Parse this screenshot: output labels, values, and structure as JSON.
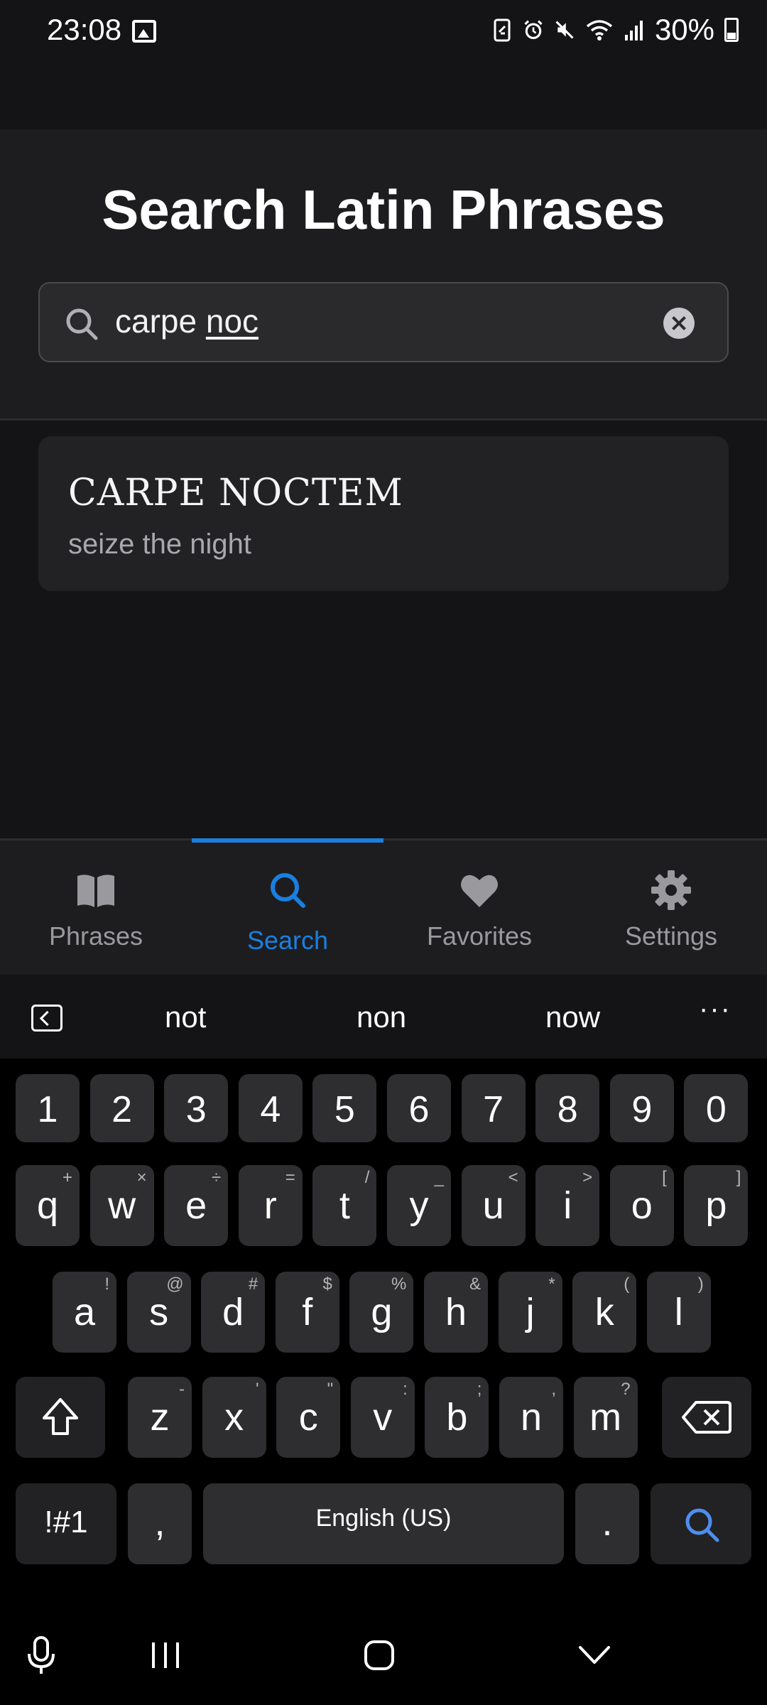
{
  "status_bar": {
    "time": "23:08",
    "battery_percent": "30%",
    "icons": [
      "image-icon",
      "battery-saver-icon",
      "alarm-icon",
      "mute-icon",
      "wifi-icon",
      "signal-icon",
      "battery-icon"
    ]
  },
  "header": {
    "title": "Search Latin Phrases"
  },
  "search": {
    "value_prefix": "carpe ",
    "value_composing": "noc",
    "icon": "search-icon",
    "clear_icon": "clear-icon"
  },
  "results": [
    {
      "latin": "CARPE NOCTEM",
      "translation": "seize the night"
    }
  ],
  "bottom_nav": {
    "items": [
      {
        "label": "Phrases",
        "icon": "book-icon",
        "active": false
      },
      {
        "label": "Search",
        "icon": "search-icon",
        "active": true
      },
      {
        "label": "Favorites",
        "icon": "heart-icon",
        "active": false
      },
      {
        "label": "Settings",
        "icon": "gear-icon",
        "active": false
      }
    ],
    "active_color": "#1a7fe0"
  },
  "keyboard": {
    "suggestions": [
      "not",
      "non",
      "now"
    ],
    "more": "···",
    "number_row": [
      "1",
      "2",
      "3",
      "4",
      "5",
      "6",
      "7",
      "8",
      "9",
      "0"
    ],
    "row1": [
      {
        "k": "q",
        "a": "+"
      },
      {
        "k": "w",
        "a": "×"
      },
      {
        "k": "e",
        "a": "÷"
      },
      {
        "k": "r",
        "a": "="
      },
      {
        "k": "t",
        "a": "/"
      },
      {
        "k": "y",
        "a": "_"
      },
      {
        "k": "u",
        "a": "<"
      },
      {
        "k": "i",
        "a": ">"
      },
      {
        "k": "o",
        "a": "["
      },
      {
        "k": "p",
        "a": "]"
      }
    ],
    "row2": [
      {
        "k": "a",
        "a": "!"
      },
      {
        "k": "s",
        "a": "@"
      },
      {
        "k": "d",
        "a": "#"
      },
      {
        "k": "f",
        "a": "$"
      },
      {
        "k": "g",
        "a": "%"
      },
      {
        "k": "h",
        "a": "&"
      },
      {
        "k": "j",
        "a": "*"
      },
      {
        "k": "k",
        "a": "("
      },
      {
        "k": "l",
        "a": ")"
      }
    ],
    "row3": [
      {
        "k": "z",
        "a": "-"
      },
      {
        "k": "x",
        "a": "'"
      },
      {
        "k": "c",
        "a": "\""
      },
      {
        "k": "v",
        "a": ":"
      },
      {
        "k": "b",
        "a": ";"
      },
      {
        "k": "n",
        "a": ","
      },
      {
        "k": "m",
        "a": "?"
      }
    ],
    "symbols_label": "!#1",
    "comma": ",",
    "space_label": "English (US)",
    "period": ".",
    "accent_color": "#4d8ff0"
  }
}
